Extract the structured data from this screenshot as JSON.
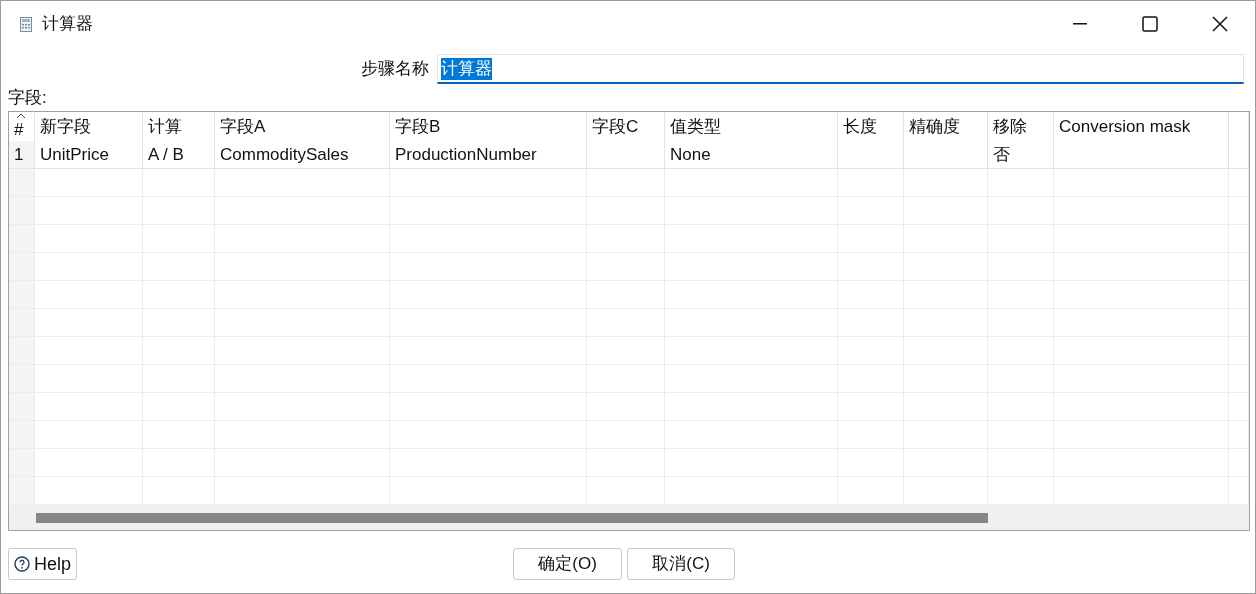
{
  "window": {
    "title": "计算器"
  },
  "step_name": {
    "label": "步骤名称",
    "value": "计算器"
  },
  "fields_label": "字段:",
  "table": {
    "columns": [
      "#",
      "新字段",
      "计算",
      "字段A",
      "字段B",
      "字段C",
      "值类型",
      "长度",
      "精确度",
      "移除",
      "Conversion mask"
    ],
    "rows": [
      [
        "1",
        "UnitPrice",
        "A / B",
        "CommoditySales",
        "ProductionNumber",
        "",
        "None",
        "",
        "",
        "否",
        ""
      ]
    ]
  },
  "buttons": {
    "help": "Help",
    "ok": "确定(O)",
    "cancel": "取消(C)"
  }
}
